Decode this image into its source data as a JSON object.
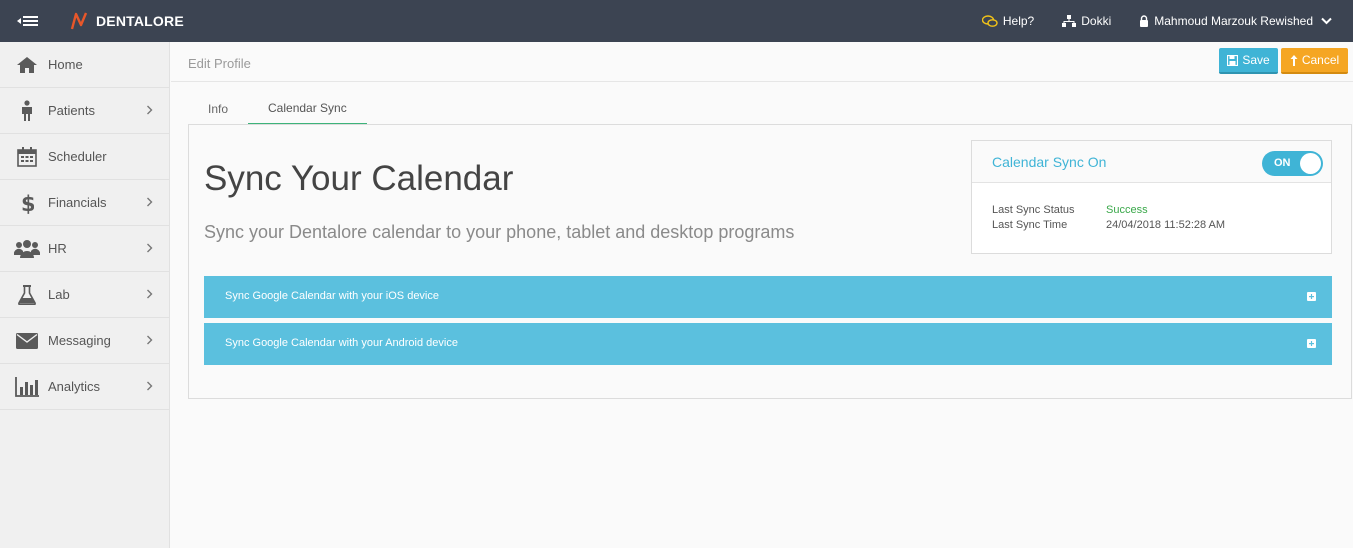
{
  "app": {
    "name": "DENTALORE",
    "help_label": "Help?",
    "branch_label": "Dokki",
    "user_name": "Mahmoud Marzouk Rewished"
  },
  "sidebar": {
    "items": [
      {
        "label": "Home",
        "icon": "home-icon",
        "has_children": false
      },
      {
        "label": "Patients",
        "icon": "person-icon",
        "has_children": true
      },
      {
        "label": "Scheduler",
        "icon": "calendar-icon",
        "has_children": false
      },
      {
        "label": "Financials",
        "icon": "dollar-icon",
        "has_children": true
      },
      {
        "label": "HR",
        "icon": "users-icon",
        "has_children": true
      },
      {
        "label": "Lab",
        "icon": "flask-icon",
        "has_children": true
      },
      {
        "label": "Messaging",
        "icon": "envelope-icon",
        "has_children": true
      },
      {
        "label": "Analytics",
        "icon": "bar-chart-icon",
        "has_children": true
      }
    ]
  },
  "header": {
    "breadcrumb": "Edit Profile",
    "save_label": "Save",
    "cancel_label": "Cancel"
  },
  "tabs": [
    {
      "label": "Info",
      "active": false
    },
    {
      "label": "Calendar Sync",
      "active": true
    }
  ],
  "content": {
    "title": "Sync Your Calendar",
    "subtitle": "Sync your Dentalore calendar to your phone, tablet and desktop programs"
  },
  "sync_status": {
    "title": "Calendar Sync On",
    "toggle_label": "ON",
    "toggle_on": true,
    "last_status_label": "Last Sync Status",
    "last_status_value": "Success",
    "last_time_label": "Last Sync Time",
    "last_time_value": "24/04/2018 11:52:28 AM"
  },
  "accordions": [
    {
      "label": "Sync Google Calendar with your iOS device"
    },
    {
      "label": "Sync Google Calendar with your Android device"
    }
  ],
  "colors": {
    "topbar": "#3c4452",
    "accent": "#3fb4d6",
    "cancel": "#f5a623",
    "active_tab": "#3cb37a",
    "success": "#3aa84a",
    "accordion": "#5bc0de",
    "logo": "#e8572a",
    "help_icon": "#f2c318"
  }
}
